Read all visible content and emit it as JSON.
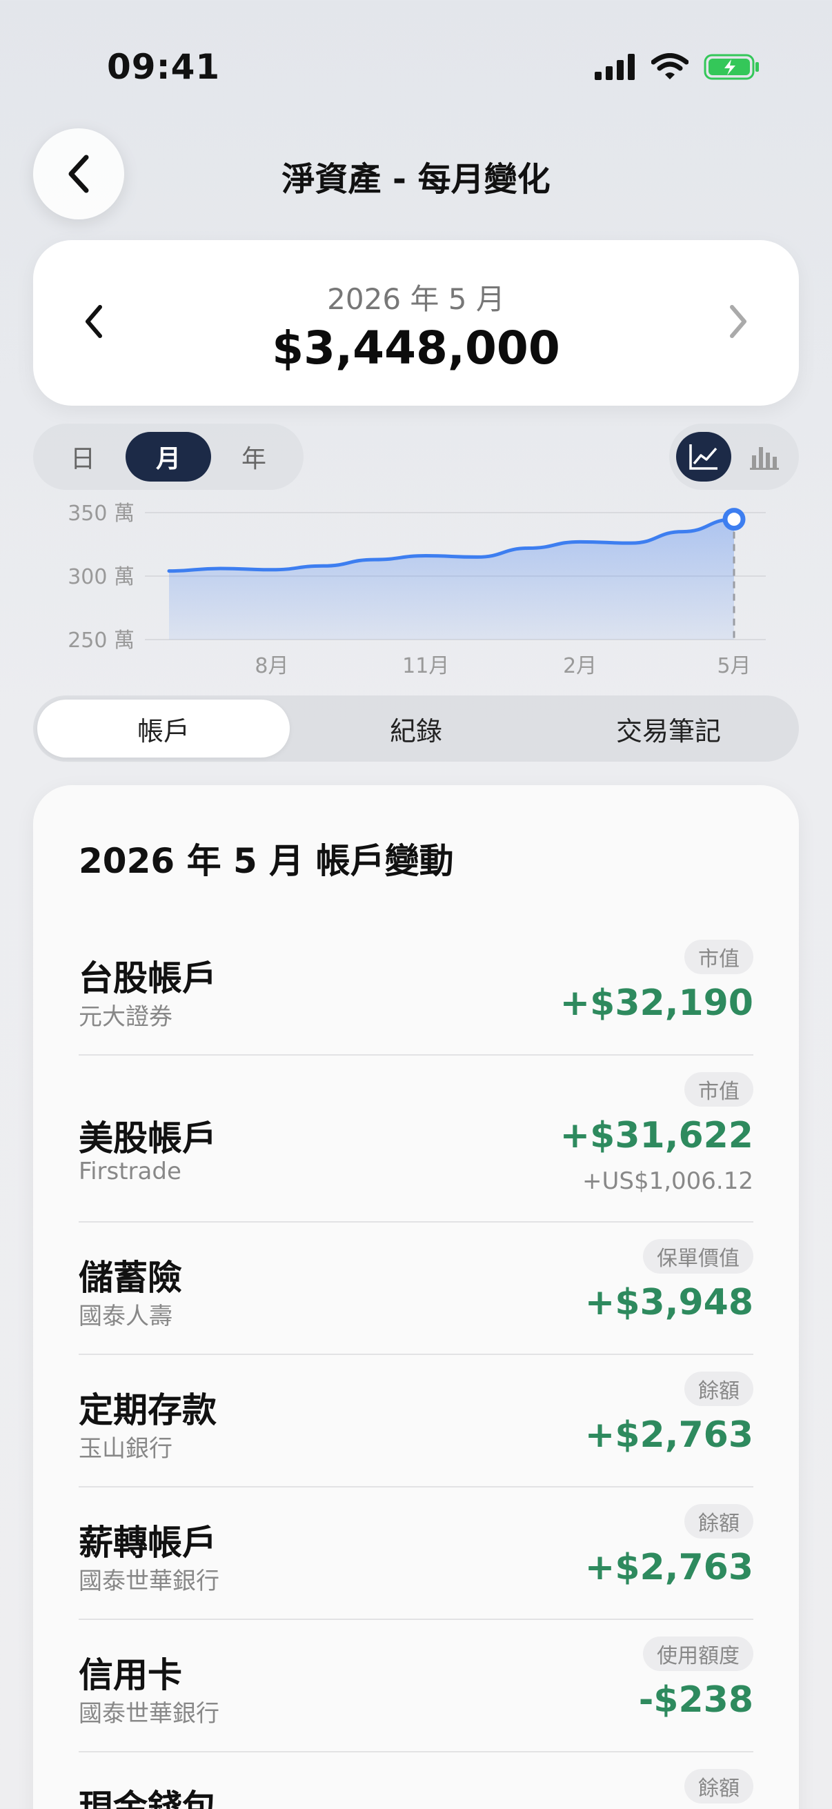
{
  "status_bar": {
    "time": "09:41"
  },
  "header": {
    "title": "淨資產 - 每月變化"
  },
  "summary": {
    "period": "2026 年 5 月",
    "net_worth": "$3,448,000"
  },
  "period_selector": {
    "options": [
      "日",
      "月",
      "年"
    ],
    "selected": "月"
  },
  "chart_type_toggle": {
    "options": [
      "line-chart-icon",
      "bar-chart-icon"
    ],
    "selected": "line-chart-icon"
  },
  "chart_data": {
    "type": "area",
    "x_ticks": [
      "8月",
      "11月",
      "2月",
      "5月"
    ],
    "y_ticks": [
      "350 萬",
      "300 萬",
      "250 萬"
    ],
    "ylim": [
      250,
      350
    ],
    "y_unit": "萬",
    "x": [
      "2025-06",
      "2025-07",
      "2025-08",
      "2025-09",
      "2025-10",
      "2025-11",
      "2025-12",
      "2026-01",
      "2026-02",
      "2026-03",
      "2026-04",
      "2026-05"
    ],
    "values": [
      304,
      306,
      305,
      308,
      313,
      316,
      315,
      322,
      327,
      326,
      335,
      344.8
    ],
    "highlight_index": 11,
    "color": "#3d7ef0",
    "grid": true
  },
  "tabs": {
    "items": [
      "帳戶",
      "紀錄",
      "交易筆記"
    ],
    "selected": "帳戶"
  },
  "account_changes": {
    "title": "2026 年 5 月 帳戶變動",
    "items": [
      {
        "name": "台股帳戶",
        "institution": "元大證券",
        "badge": "市值",
        "change": "+$32,190",
        "sub": ""
      },
      {
        "name": "美股帳戶",
        "institution": "Firstrade",
        "badge": "市值",
        "change": "+$31,622",
        "sub": "+US$1,006.12"
      },
      {
        "name": "儲蓄險",
        "institution": "國泰人壽",
        "badge": "保單價值",
        "change": "+$3,948",
        "sub": ""
      },
      {
        "name": "定期存款",
        "institution": "玉山銀行",
        "badge": "餘額",
        "change": "+$2,763",
        "sub": ""
      },
      {
        "name": "薪轉帳戶",
        "institution": "國泰世華銀行",
        "badge": "餘額",
        "change": "+$2,763",
        "sub": ""
      },
      {
        "name": "信用卡",
        "institution": "國泰世華銀行",
        "badge": "使用額度",
        "change": "-$238",
        "sub": ""
      },
      {
        "name": "現金錢包",
        "institution": "",
        "badge": "餘額",
        "change": "",
        "sub": ""
      }
    ]
  }
}
